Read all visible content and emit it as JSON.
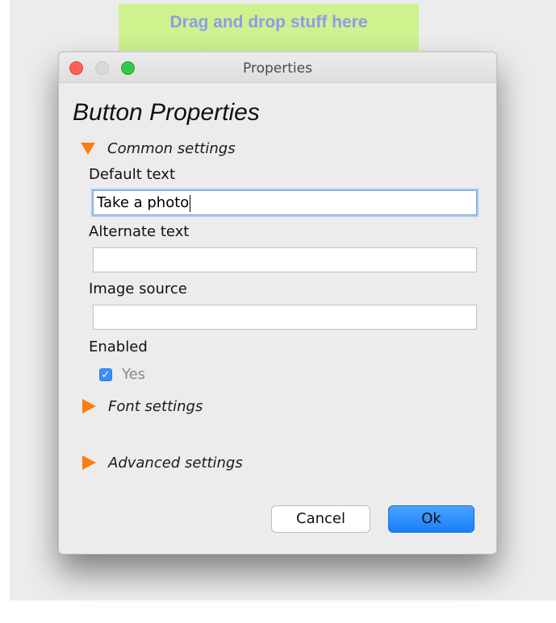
{
  "drop_zone": {
    "text": "Drag and drop stuff here"
  },
  "window": {
    "title": "Properties"
  },
  "dialog": {
    "heading": "Button Properties",
    "sections": {
      "common": "Common settings",
      "font": "Font settings",
      "advanced": "Advanced settings"
    },
    "fields": {
      "default_text": {
        "label": "Default text",
        "value": "Take a photo"
      },
      "alternate_text": {
        "label": "Alternate text",
        "value": ""
      },
      "image_source": {
        "label": "Image source",
        "value": ""
      }
    },
    "enabled": {
      "label": "Enabled",
      "checkbox_label": "Yes",
      "checked": true
    },
    "buttons": {
      "cancel": "Cancel",
      "ok": "Ok"
    }
  },
  "colors": {
    "drop_zone_bg": "#cdf28e",
    "drop_zone_text": "#8e9ce9",
    "disclosure_triangle": "#fb7d12",
    "ok_button": "#1a7ef6"
  },
  "icons": {
    "expanded": "triangle-down-icon",
    "collapsed": "triangle-right-icon",
    "check": "checkmark-icon"
  }
}
